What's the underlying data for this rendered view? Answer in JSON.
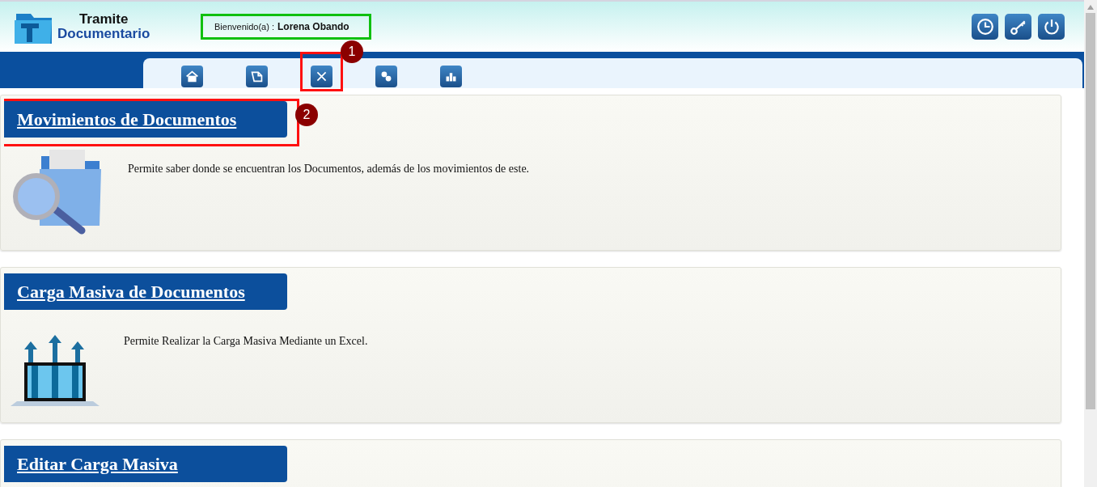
{
  "header": {
    "logo": {
      "line1": "Tramite",
      "line2": "Documentario"
    },
    "welcome": {
      "label": "Bienvenido(a) :",
      "name": "Lorena Obando",
      "highlighted": true
    },
    "actions": [
      {
        "kind": "clock"
      },
      {
        "kind": "key"
      },
      {
        "kind": "power"
      }
    ]
  },
  "nav_tabs": [
    {
      "kind": "home",
      "highlighted": false
    },
    {
      "kind": "document",
      "highlighted": false
    },
    {
      "kind": "tools",
      "highlighted": true,
      "callout": "1"
    },
    {
      "kind": "gears",
      "highlighted": false
    },
    {
      "kind": "chart",
      "highlighted": false
    }
  ],
  "sections": [
    {
      "title": "Movimientos de Documentos",
      "description": "Permite saber donde se encuentran los Documentos, además de los movimientos de este.",
      "kind": "folder-search",
      "highlighted": true,
      "callout": "2"
    },
    {
      "title": "Carga Masiva de Documentos",
      "description": "Permite Realizar la Carga Masiva Mediante un Excel.",
      "kind": "laptop-upload",
      "highlighted": false
    },
    {
      "title": "Editar Carga Masiva",
      "highlighted": false
    }
  ]
}
